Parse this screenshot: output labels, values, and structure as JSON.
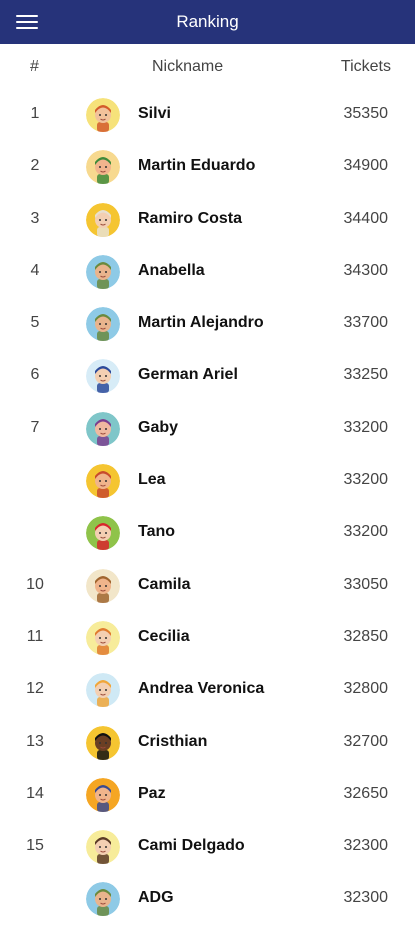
{
  "appbar": {
    "title": "Ranking",
    "menu_icon": "hamburger-menu-icon"
  },
  "columns": {
    "rank": "#",
    "nickname": "Nickname",
    "tickets": "Tickets"
  },
  "rows": [
    {
      "rank": "1",
      "nickname": "Silvi",
      "tickets": "35350",
      "avatar": {
        "bg": "#f6e27a",
        "skin": "#f2c29b",
        "hair": "#d35b2b"
      }
    },
    {
      "rank": "2",
      "nickname": "Martin Eduardo",
      "tickets": "34900",
      "avatar": {
        "bg": "#f7d98f",
        "skin": "#f2b48d",
        "hair": "#3f8a3a"
      }
    },
    {
      "rank": "3",
      "nickname": "Ramiro Costa",
      "tickets": "34400",
      "avatar": {
        "bg": "#f5c531",
        "skin": "#f3cfb2",
        "hair": "#e8e0d0"
      }
    },
    {
      "rank": "4",
      "nickname": "Anabella",
      "tickets": "34300",
      "avatar": {
        "bg": "#8ecae6",
        "skin": "#e9b48d",
        "hair": "#6a8a3e"
      }
    },
    {
      "rank": "5",
      "nickname": "Martin Alejandro",
      "tickets": "33700",
      "avatar": {
        "bg": "#8ecae6",
        "skin": "#e9b48d",
        "hair": "#6a8a3e"
      }
    },
    {
      "rank": "6",
      "nickname": "German Ariel",
      "tickets": "33250",
      "avatar": {
        "bg": "#d7ecf7",
        "skin": "#f3cfb2",
        "hair": "#2c4a9a"
      }
    },
    {
      "rank": "7",
      "nickname": "Gaby",
      "tickets": "33200",
      "avatar": {
        "bg": "#7fc6c9",
        "skin": "#f0b9a0",
        "hair": "#7b3f8f"
      }
    },
    {
      "rank": "",
      "nickname": "Lea",
      "tickets": "33200",
      "avatar": {
        "bg": "#f5c531",
        "skin": "#f0b48b",
        "hair": "#c84a2d"
      }
    },
    {
      "rank": "",
      "nickname": "Tano",
      "tickets": "33200",
      "avatar": {
        "bg": "#8fc34a",
        "skin": "#f3cfb2",
        "hair": "#d8262b"
      }
    },
    {
      "rank": "10",
      "nickname": "Camila",
      "tickets": "33050",
      "avatar": {
        "bg": "#f2e6c9",
        "skin": "#f0b48b",
        "hair": "#a0652f"
      }
    },
    {
      "rank": "11",
      "nickname": "Cecilia",
      "tickets": "32850",
      "avatar": {
        "bg": "#f7ec9a",
        "skin": "#f3cfb2",
        "hair": "#e07b2f"
      }
    },
    {
      "rank": "12",
      "nickname": "Andrea Veronica",
      "tickets": "32800",
      "avatar": {
        "bg": "#cfe9f5",
        "skin": "#f3cfb2",
        "hair": "#f0a63a"
      }
    },
    {
      "rank": "13",
      "nickname": "Cristhian",
      "tickets": "32700",
      "avatar": {
        "bg": "#f5c531",
        "skin": "#6b3f23",
        "hair": "#111111"
      }
    },
    {
      "rank": "14",
      "nickname": "Paz",
      "tickets": "32650",
      "avatar": {
        "bg": "#f5a623",
        "skin": "#f0b48b",
        "hair": "#3b4a8f"
      }
    },
    {
      "rank": "15",
      "nickname": "Cami Delgado",
      "tickets": "32300",
      "avatar": {
        "bg": "#f7ec9a",
        "skin": "#f3cfb2",
        "hair": "#5a3a26"
      }
    },
    {
      "rank": "",
      "nickname": "ADG",
      "tickets": "32300",
      "avatar": {
        "bg": "#8ecae6",
        "skin": "#e9b48d",
        "hair": "#6a8a3e"
      }
    }
  ]
}
